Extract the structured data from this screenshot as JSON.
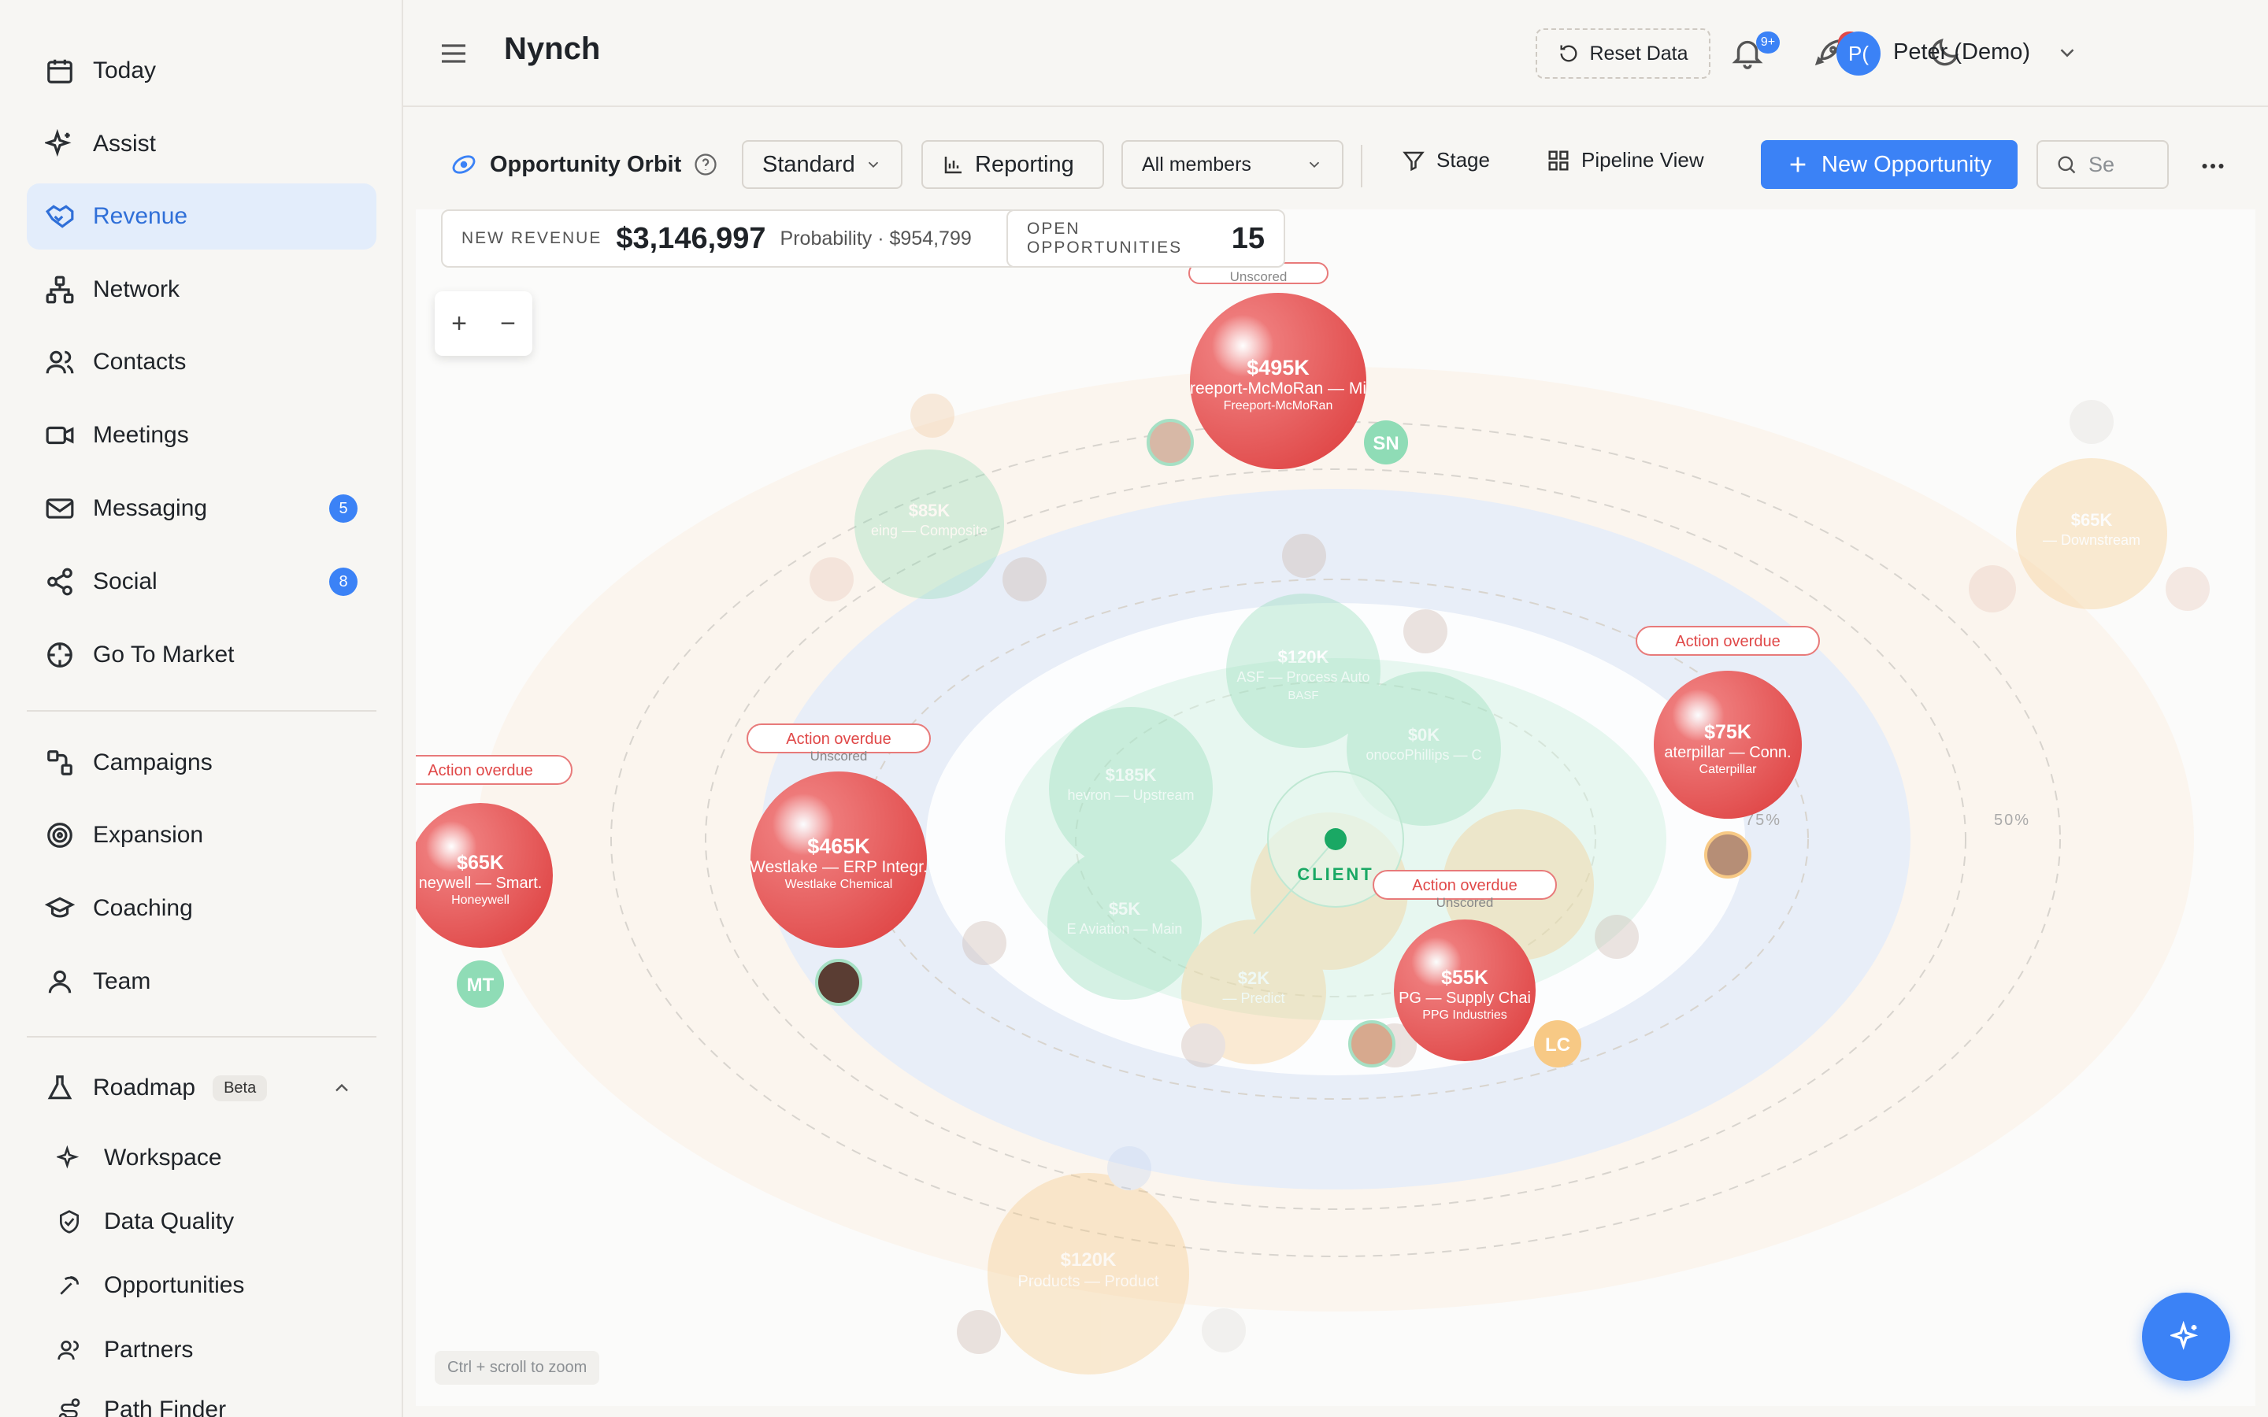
{
  "sidebar": {
    "items": [
      {
        "label": "Today",
        "icon": "calendar-icon"
      },
      {
        "label": "Assist",
        "icon": "sparkle-icon"
      },
      {
        "label": "Revenue",
        "icon": "handshake-icon",
        "active": true
      },
      {
        "label": "Network",
        "icon": "network-icon"
      },
      {
        "label": "Contacts",
        "icon": "users-icon"
      },
      {
        "label": "Meetings",
        "icon": "video-icon"
      },
      {
        "label": "Messaging",
        "icon": "mail-icon",
        "badge": "5"
      },
      {
        "label": "Social",
        "icon": "share-icon",
        "badge": "8"
      },
      {
        "label": "Go To Market",
        "icon": "crosshair-icon"
      },
      {
        "label": "Campaigns",
        "icon": "flow-icon"
      },
      {
        "label": "Expansion",
        "icon": "target-icon"
      },
      {
        "label": "Coaching",
        "icon": "graduation-cap-icon"
      },
      {
        "label": "Team",
        "icon": "team-icon"
      }
    ],
    "roadmap": {
      "label": "Roadmap",
      "badge": "Beta"
    },
    "sub_items": [
      {
        "label": "Workspace",
        "icon": "sparkle-icon"
      },
      {
        "label": "Data Quality",
        "icon": "shield-check-icon"
      },
      {
        "label": "Opportunities",
        "icon": "pickaxe-icon"
      },
      {
        "label": "Partners",
        "icon": "users-icon"
      },
      {
        "label": "Path Finder",
        "icon": "route-icon"
      }
    ]
  },
  "header": {
    "app_title": "Nynch",
    "reset_label": "Reset Data",
    "notif_badge": "9+",
    "rocket_badge": "9+",
    "avatar_initials": "P(",
    "user_name": "Peter (Demo)"
  },
  "toolbar": {
    "title": "Opportunity Orbit",
    "view_select": "Standard",
    "reporting": "Reporting",
    "members_select": "All members",
    "stage": "Stage",
    "pipeline_view": "Pipeline View",
    "new_opportunity": "New Opportunity",
    "search_placeholder": "Se"
  },
  "stats": {
    "new_revenue_label": "NEW REVENUE",
    "new_revenue_value": "$3,146,997",
    "probability_text": "Probability · $954,799",
    "open_opps_label": "OPEN OPPORTUNITIES",
    "open_opps_value": "15"
  },
  "orbit": {
    "center_label": "CLIENT",
    "ring_labels": [
      "75%",
      "50%"
    ],
    "hint": "Ctrl + scroll to zoom",
    "zoom_in": "+",
    "zoom_out": "−",
    "colors": {
      "red": "#e04848",
      "green": "#8fdcb6",
      "orange": "#f7c985",
      "blue": "#dbe7fb",
      "accent": "#3b82f6"
    },
    "active_opportunities": [
      {
        "amount": "$495K",
        "name": "reeport-McMoRan — Mi",
        "company": "Freeport-McMoRan",
        "tag": "Unscored"
      },
      {
        "amount": "$465K",
        "name": "Westlake — ERP Integr.",
        "company": "Westlake Chemical",
        "tag": "Unscored",
        "alert": "Action overdue"
      },
      {
        "amount": "$65K",
        "name": "neywell — Smart.",
        "company": "Honeywell",
        "alert": "Action overdue"
      },
      {
        "amount": "$75K",
        "name": "aterpillar — Conn.",
        "company": "Caterpillar",
        "alert": "Action overdue"
      },
      {
        "amount": "$55K",
        "name": "PG — Supply Chai",
        "company": "PPG Industries",
        "tag": "Unscored",
        "alert": "Action overdue"
      }
    ],
    "faded_opportunities": [
      {
        "amount": "$85K",
        "name": "eing — Composite"
      },
      {
        "amount": "$120K",
        "name": "ASF — Process Auto",
        "company": "BASF"
      },
      {
        "amount": "$185K",
        "name": "hevron — Upstream"
      },
      {
        "amount": "$0K",
        "name": "onocoPhillips — C"
      },
      {
        "amount": "$5K",
        "name": "E Aviation — Main"
      },
      {
        "amount": "$2K",
        "name": "— Predict"
      },
      {
        "amount": "$120K",
        "name": "Products — Product"
      },
      {
        "amount": "$65K",
        "name": "— Downstream"
      }
    ],
    "member_initials": [
      "SN",
      "MT",
      "LC"
    ]
  }
}
